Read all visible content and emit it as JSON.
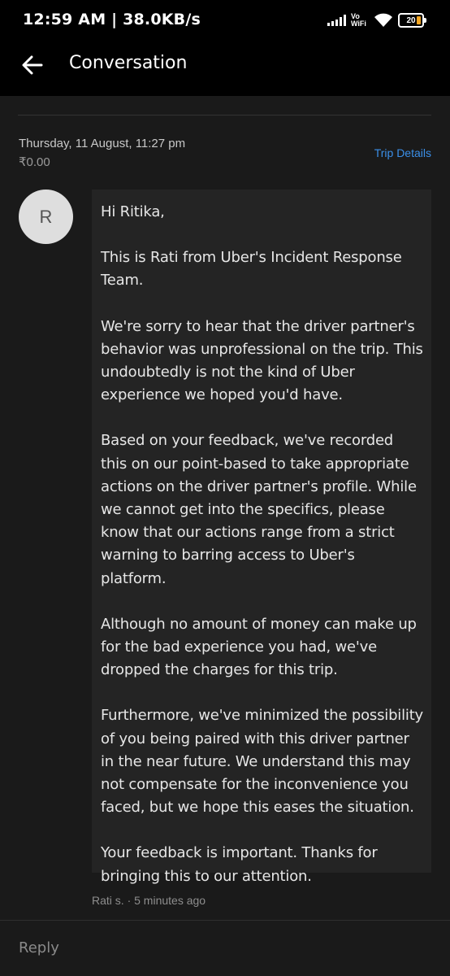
{
  "status_bar": {
    "time": "12:59 AM | 38.0KB/s",
    "network_label": "Vo WiFi",
    "battery_level": "20",
    "icons": [
      "signal-icon",
      "wifi-icon",
      "battery-icon"
    ]
  },
  "header": {
    "title": "Conversation",
    "back_icon": "arrow-left-icon"
  },
  "message": {
    "date": "Thursday, 11 August, 11:27 pm",
    "amount": "₹0.00",
    "trip_details_label": "Trip Details",
    "avatar_initial": "R",
    "paragraphs": [
      "Hi Ritika,",
      "This is Rati from Uber's Incident Response Team.",
      "We're sorry to hear that the driver partner's behavior was unprofessional on the trip. This undoubtedly is not the kind of Uber experience we hoped you'd have.",
      "Based on your feedback, we've recorded this on our point-based to take appropriate actions on the driver partner's profile. While we cannot get into the specifics, please know that our actions range from a strict warning to barring access to Uber's platform.",
      "Although no amount of money can make up for the bad experience you had, we've dropped the charges for this trip.",
      "Furthermore, we've minimized the possibility of you being paired with this driver partner in the near future. We understand this may not compensate for the inconvenience you faced, but we hope this eases the situation.",
      "Your feedback is important. Thanks for bringing this to our attention."
    ],
    "sender": "Rati s. · 5 minutes ago"
  },
  "reply": {
    "placeholder": "Reply",
    "value": ""
  },
  "colors": {
    "background": "#1a1a1a",
    "bubble": "#242424",
    "link": "#3b8fe8",
    "battery_accent": "#f4a623"
  }
}
